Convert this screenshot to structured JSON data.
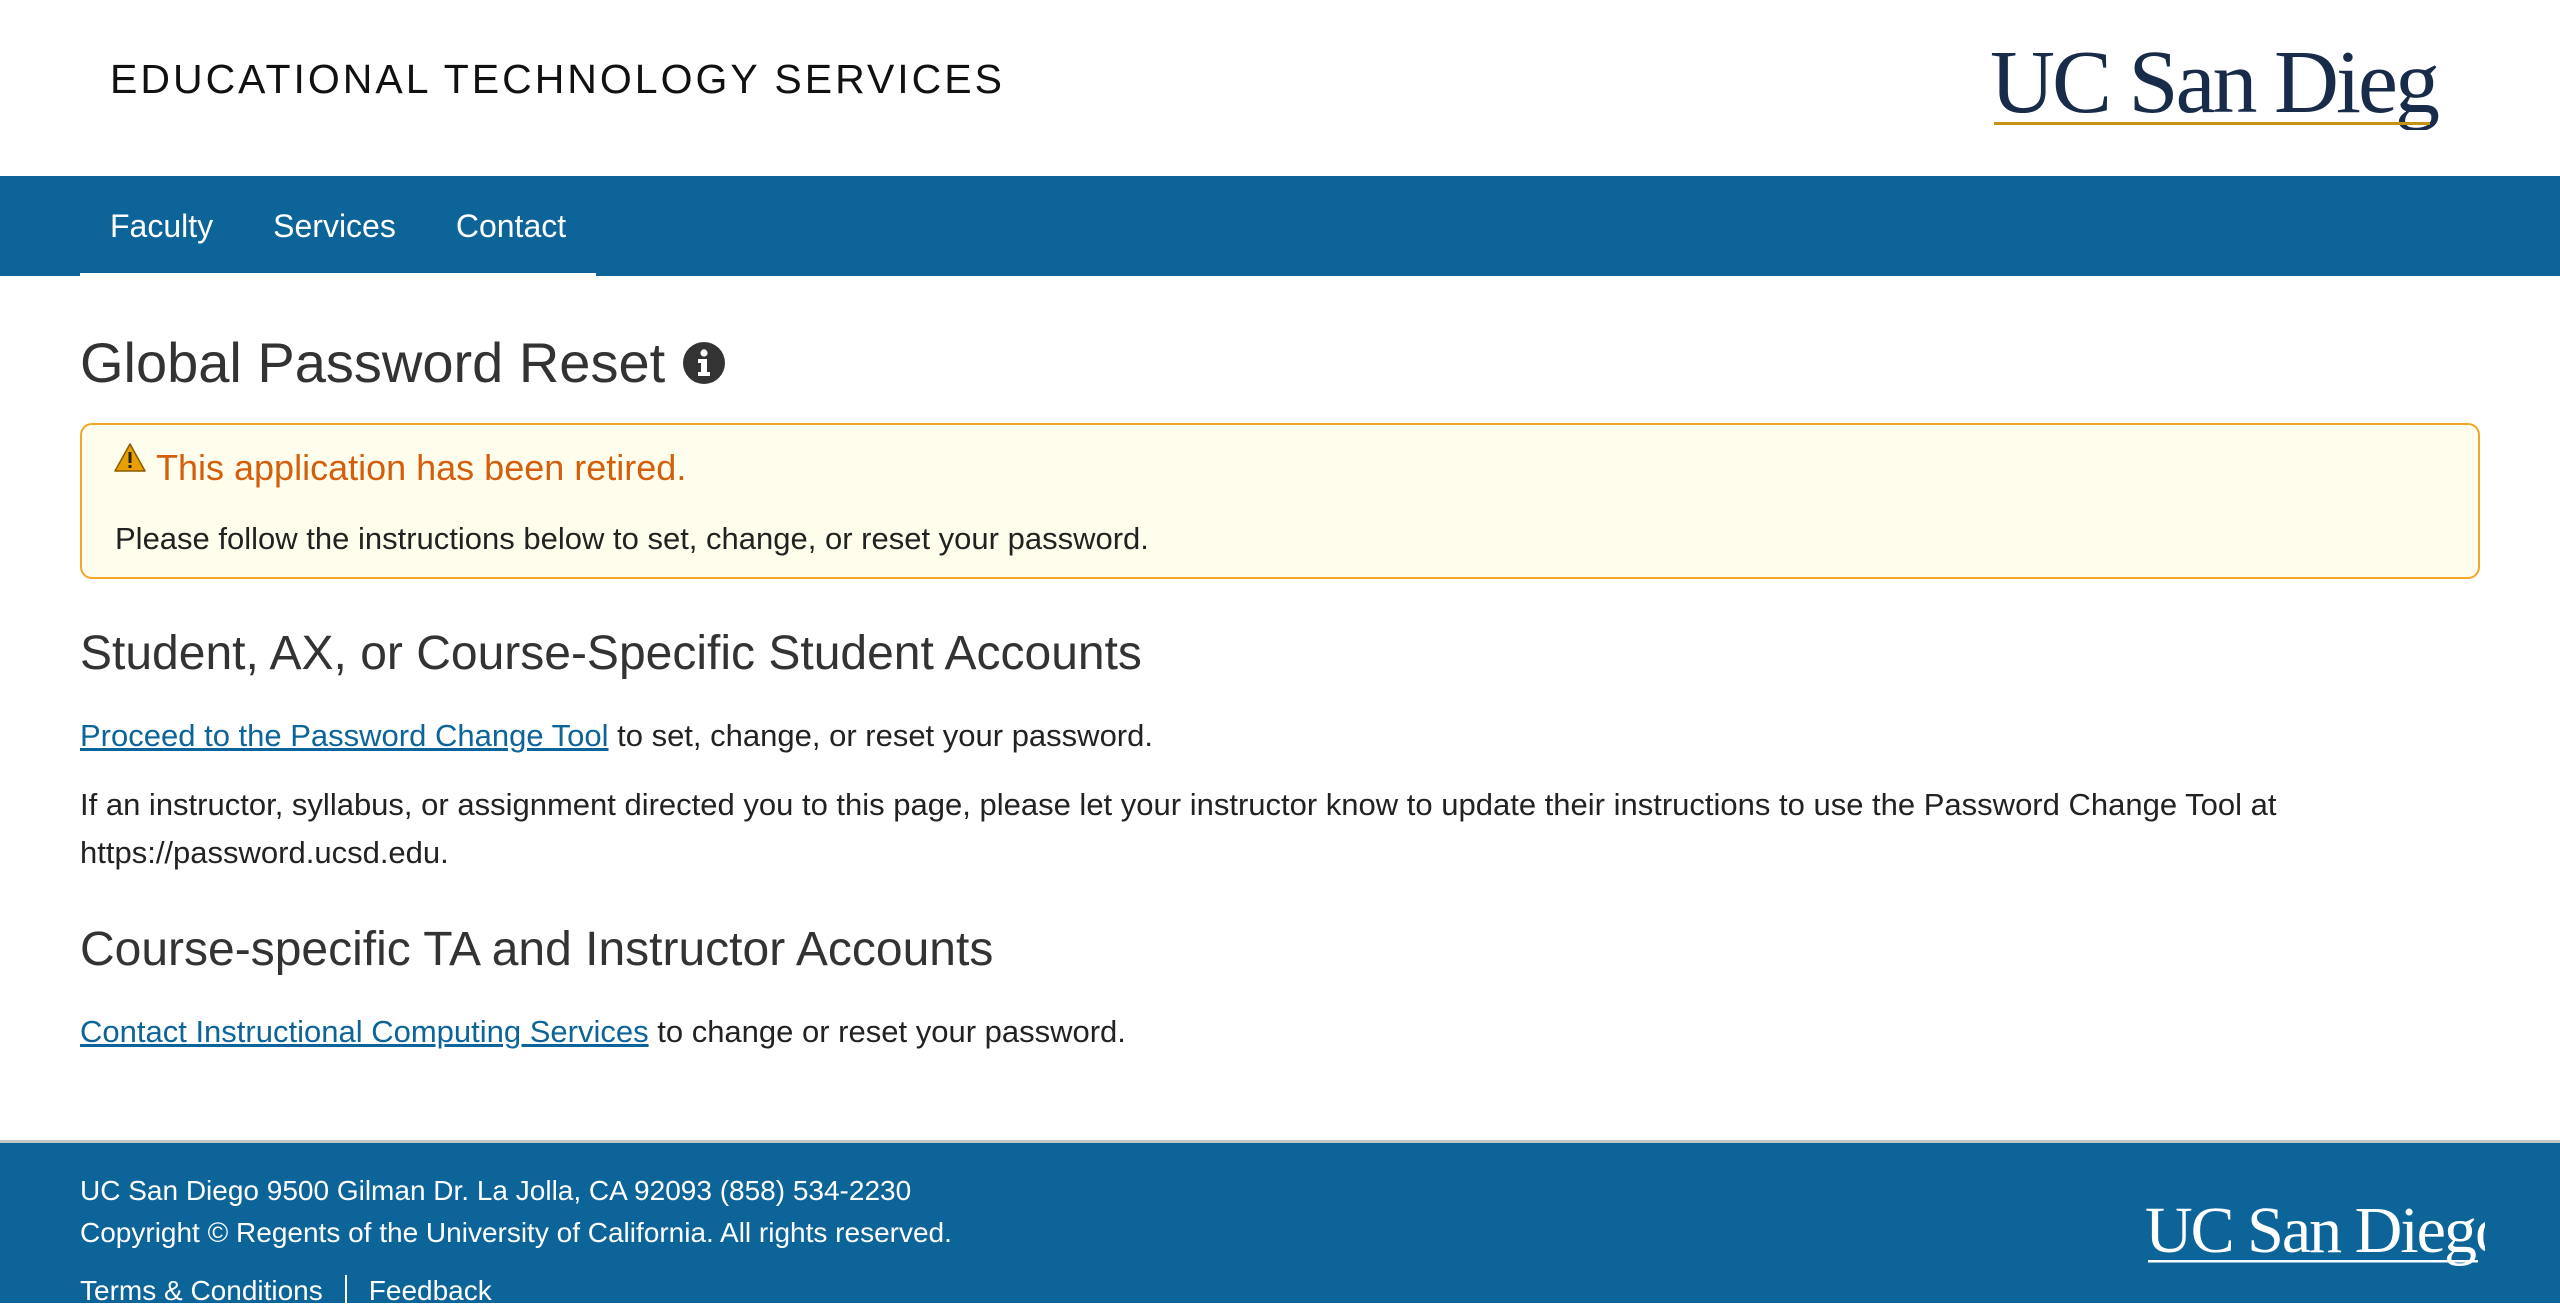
{
  "header": {
    "site_title": "EDUCATIONAL TECHNOLOGY SERVICES",
    "logo_text": "UC San Diego"
  },
  "nav": {
    "items": [
      {
        "label": "Faculty"
      },
      {
        "label": "Services"
      },
      {
        "label": "Contact"
      }
    ]
  },
  "page": {
    "title": "Global Password Reset",
    "info_icon": "info-circle-icon"
  },
  "alert": {
    "icon": "warning-triangle-icon",
    "heading": "This application has been retired.",
    "body": "Please follow the instructions below to set, change, or reset your password."
  },
  "sections": [
    {
      "heading": "Student, AX, or Course-Specific Student Accounts",
      "link_text": "Proceed to the Password Change Tool",
      "link_tail": " to set, change, or reset your password.",
      "paragraph": "If an instructor, syllabus, or assignment directed you to this page, please let your instructor know to update their instructions to use the Password Change Tool at https://password.ucsd.edu."
    },
    {
      "heading": "Course-specific TA and Instructor Accounts",
      "link_text": "Contact Instructional Computing Services",
      "link_tail": " to change or reset your password."
    }
  ],
  "footer": {
    "address": "UC San Diego 9500 Gilman Dr. La Jolla, CA 92093 (858) 534-2230",
    "copyright": "Copyright © Regents of the University of California. All rights reserved.",
    "links": [
      {
        "label": "Terms & Conditions"
      },
      {
        "label": "Feedback"
      }
    ],
    "logo_text": "UC San Diego"
  },
  "colors": {
    "brand_blue": "#0c6499",
    "logo_navy": "#182b49",
    "logo_gold": "#c69214",
    "alert_orange": "#d35f0c",
    "alert_border": "#f0a728",
    "alert_bg": "#fffeec"
  }
}
